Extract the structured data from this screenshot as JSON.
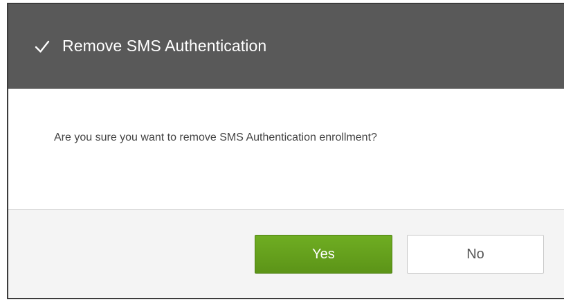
{
  "dialog": {
    "title": "Remove SMS Authentication",
    "message": "Are you sure you want to remove SMS Authentication enrollment?",
    "yes_label": "Yes",
    "no_label": "No",
    "icons": {
      "title_icon": "checkmark-icon"
    },
    "colors": {
      "header_bg": "#595959",
      "yes_bg": "#66a01d",
      "footer_bg": "#f4f4f4"
    }
  }
}
